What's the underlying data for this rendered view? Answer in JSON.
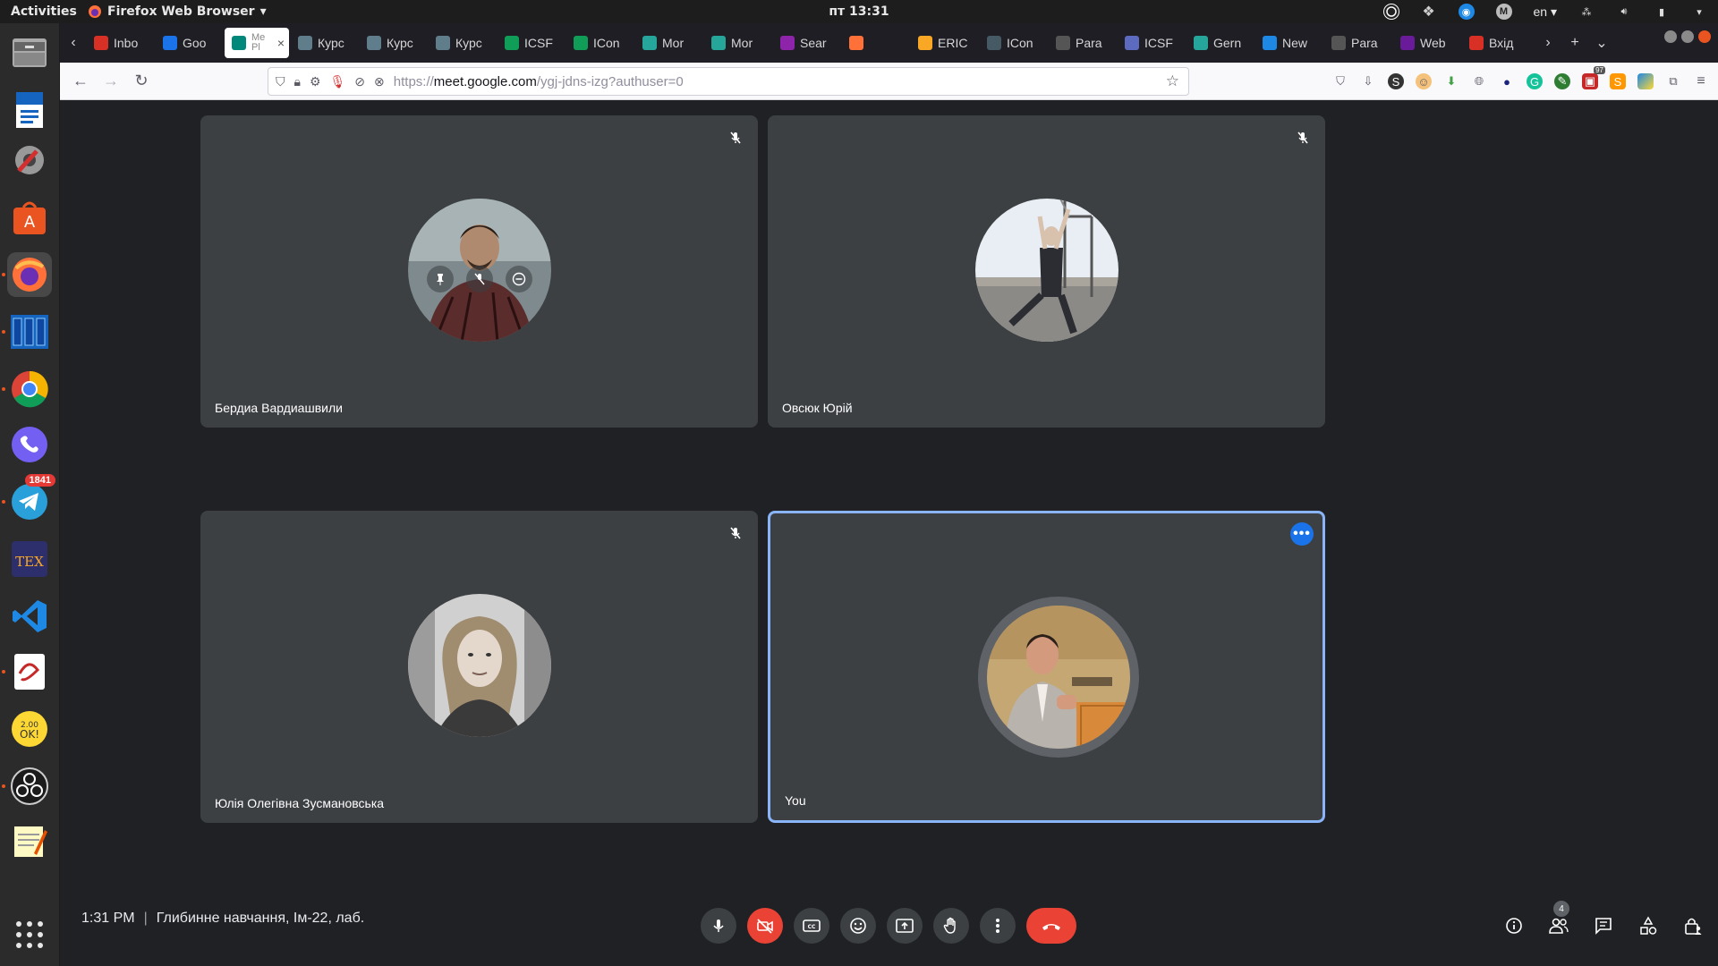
{
  "os_topbar": {
    "activities": "Activities",
    "app_name": "Firefox Web Browser",
    "clock": "пт 13:31",
    "language": "en"
  },
  "dock": {
    "telegram_badge": "1841",
    "items": [
      "files",
      "writer",
      "settings",
      "software",
      "firefox",
      "apps-grid-tool",
      "chrome",
      "viber",
      "telegram",
      "texstudio",
      "vscode",
      "document-viewer",
      "clock-app",
      "obs",
      "text-editor",
      "show-applications"
    ]
  },
  "browser": {
    "tabs": [
      {
        "label": "Inbo",
        "icon": "mail-icon",
        "color": "#d93025"
      },
      {
        "label": "Goo",
        "icon": "google-calendar-icon",
        "color": "#1a73e8"
      },
      {
        "label": "Me Pl",
        "icon": "meet-icon",
        "color": "#00897b",
        "active": true
      },
      {
        "label": "Курс",
        "icon": "course-icon",
        "color": "#607d8b"
      },
      {
        "label": "Курс",
        "icon": "course-icon",
        "color": "#607d8b"
      },
      {
        "label": "Курс",
        "icon": "course-icon",
        "color": "#607d8b"
      },
      {
        "label": "ICSF",
        "icon": "sheets-icon",
        "color": "#0f9d58"
      },
      {
        "label": "ICon",
        "icon": "sheets-icon",
        "color": "#0f9d58"
      },
      {
        "label": "Mor",
        "icon": "mor-icon",
        "color": "#26a69a"
      },
      {
        "label": "Mor",
        "icon": "mor-icon",
        "color": "#26a69a"
      },
      {
        "label": "Sear",
        "icon": "search-site-icon",
        "color": "#8e24aa"
      },
      {
        "label": "",
        "icon": "firefox-icon",
        "color": "#ff7139"
      },
      {
        "label": "ERIC",
        "icon": "eric-icon",
        "color": "#f9a825"
      },
      {
        "label": "ICon",
        "icon": "icon-site-icon",
        "color": "#455a64"
      },
      {
        "label": "Para",
        "icon": "pen-icon",
        "color": "#555555"
      },
      {
        "label": "ICSF",
        "icon": "icsf-icon",
        "color": "#5c6bc0"
      },
      {
        "label": "Gern",
        "icon": "gern-icon",
        "color": "#26a69a"
      },
      {
        "label": "New",
        "icon": "new-icon",
        "color": "#1e88e5"
      },
      {
        "label": "Para",
        "icon": "pen-icon",
        "color": "#555555"
      },
      {
        "label": "Web",
        "icon": "web-icon",
        "color": "#6a1b9a"
      },
      {
        "label": "Вхід",
        "icon": "gmail-icon",
        "color": "#d93025"
      }
    ],
    "url_prefix": "https://",
    "url_domain": "meet.google.com",
    "url_path": "/ygj-jdns-izg?authuser=0",
    "extension_badge": "97"
  },
  "meet": {
    "participants": [
      {
        "name": "Бердиа Вардиашвили",
        "muted": true
      },
      {
        "name": "Овсюк Юрій",
        "muted": true
      },
      {
        "name": "Юлія Олегівна Зусмановська",
        "muted": true
      },
      {
        "name": "You",
        "self": true
      }
    ],
    "time": "1:31 PM",
    "separator": "|",
    "meeting_title": "Глибинне навчання, Ім-22, лаб.",
    "people_count": "4",
    "more_dots": "•••"
  }
}
